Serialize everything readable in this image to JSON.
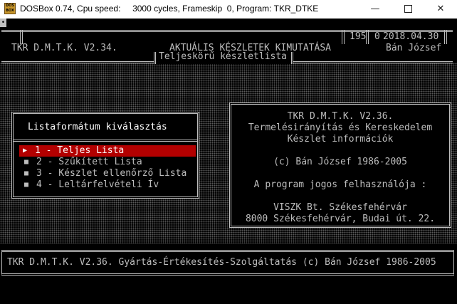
{
  "window": {
    "icon_text": "DOS BOX",
    "title": "DOSBox 0.74, Cpu speed:     3000 cycles, Frameskip  0, Program: TKR_DTKE",
    "minimize": "—",
    "close": "✕"
  },
  "dos": {
    "system_button": "•",
    "header": {
      "app_version": "TKR D.M.T.K. V2.34.",
      "title": "AKTUÁLIS KÉSZLETEK KIMUTATÁSA",
      "subtitle": "Teljeskörű készletlista",
      "counter": "195",
      "counter2": "0",
      "date": "2018.04.30",
      "user": "Bán József"
    },
    "menu": {
      "title": "Listaformátum kiválasztás",
      "selected_marker": "▶",
      "marker": "■",
      "items": [
        {
          "label": "1 - Teljes Lista"
        },
        {
          "label": "2 - Szűkített Lista"
        },
        {
          "label": "3 - Készlet ellenőrző Lista"
        },
        {
          "label": "4 - Leltárfelvételi Ív"
        }
      ],
      "colors": {
        "selected_bg": "#b30000",
        "selected_fg": "#ffffff"
      }
    },
    "info": {
      "lines": [
        "TKR D.M.T.K. V2.36.",
        "Termelésirányítás és Kereskedelem",
        "Készlet információk",
        "(c) Bán József 1986-2005",
        "A program jogos felhasználója :",
        "VISZK Bt. Székesfehérvár",
        "8000 Székesfehérvár, Budai út. 22."
      ]
    },
    "footer": {
      "text": "TKR D.M.T.K. V2.36. Gyártás-Értékesítés-Szolgáltatás (c) Bán József 1986-2005"
    }
  }
}
